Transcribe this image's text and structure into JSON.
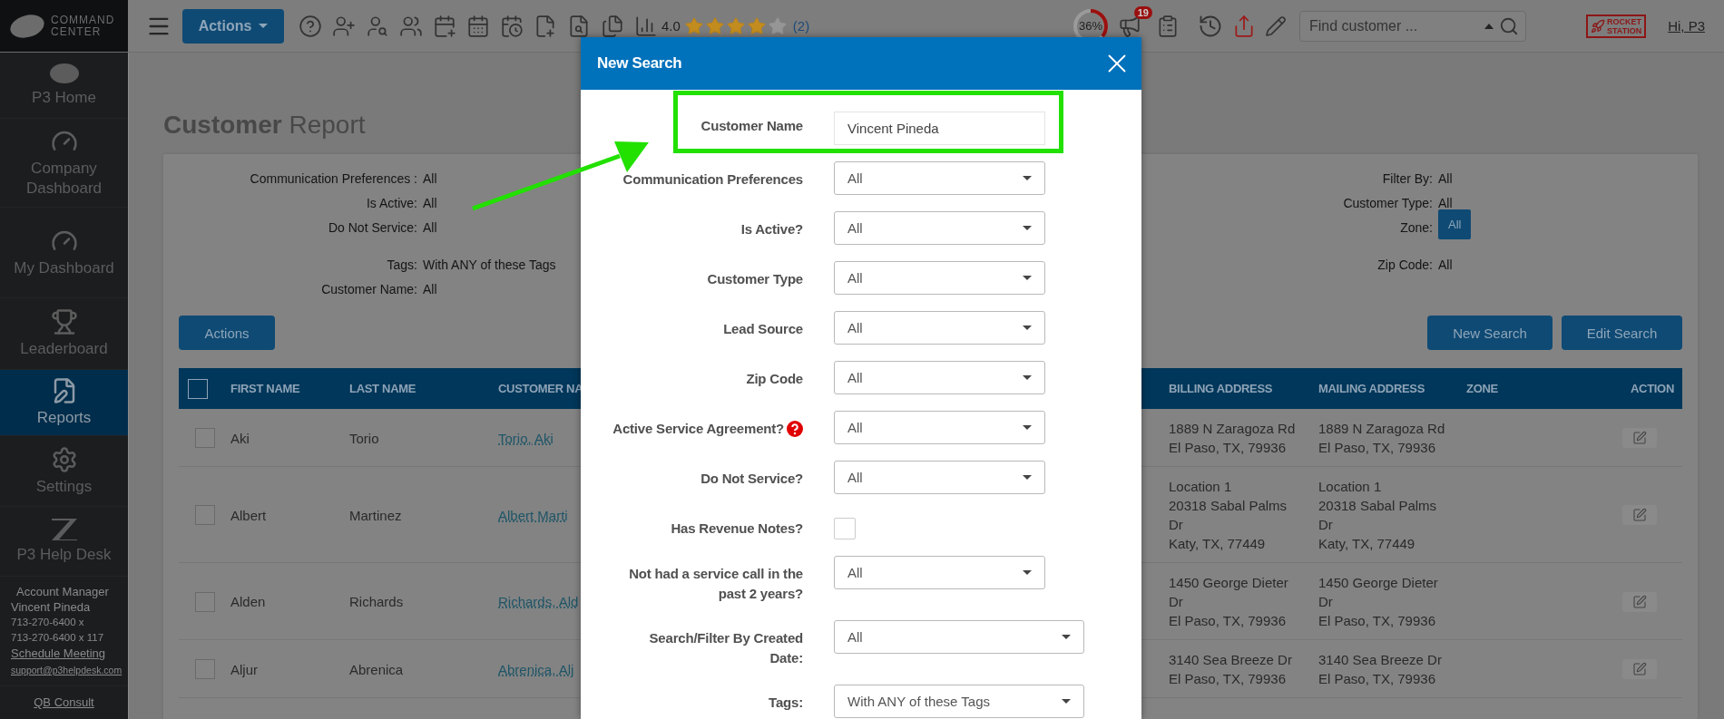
{
  "topbar": {
    "logo_lines": [
      "COMMAND",
      "CENTER"
    ],
    "actions_button": "Actions",
    "rating": {
      "value": "4.0",
      "stars": 4,
      "count": "(2)"
    },
    "progress": {
      "label": "36%",
      "level": 0.36
    },
    "notifications_badge": "19",
    "search": {
      "placeholder": "Find customer ..."
    },
    "brand_lines": [
      "ROCKET",
      "STATION"
    ],
    "greeting": "Hi, P3"
  },
  "sidebar": {
    "items": [
      {
        "label": "P3 Home",
        "selected": false
      },
      {
        "label": "Company Dashboard",
        "selected": false
      },
      {
        "label": "My Dashboard",
        "selected": false
      },
      {
        "label": "Leaderboard",
        "selected": false
      },
      {
        "label": "Reports",
        "selected": true
      },
      {
        "label": "Settings",
        "selected": false
      },
      {
        "label": "P3 Help Desk",
        "selected": false
      }
    ],
    "account": {
      "title": "Account Manager",
      "name": "Vincent Pineda",
      "phones": [
        "713-270-6400 x",
        "713-270-6400 x 117"
      ],
      "schedule_link": "Schedule Meeting",
      "email": "support@p3helpdesk.com"
    },
    "footer_link": "QB Consult"
  },
  "page": {
    "title": "**Customer** Report",
    "filters_left": [
      {
        "label": "Communication Preferences :",
        "value": "All"
      },
      {
        "label": "Is Active:",
        "value": "All"
      },
      {
        "label": "Do Not Service:",
        "value": "All"
      },
      {
        "label": "Tags:",
        "value": "With ANY of these Tags"
      },
      {
        "label": "Customer Name:",
        "value": "All"
      }
    ],
    "filters_right": [
      {
        "label": "Filter By:",
        "value": "All",
        "kind": "text"
      },
      {
        "label": "Customer Type:",
        "value": "All",
        "kind": "text"
      },
      {
        "label": "Zone:",
        "value": "All",
        "kind": "badge"
      },
      {
        "label": "Zip Code:",
        "value": "All",
        "kind": "text"
      }
    ],
    "actions_button": "Actions",
    "buttons": [
      "New Search",
      "Edit Search"
    ]
  },
  "table": {
    "header_checked": false,
    "columns": [
      "FIRST NAME",
      "LAST NAME",
      "CUSTOMER NA",
      "BILLING ADDRESS",
      "MAILING ADDRESS",
      "ZONE",
      "ACTION"
    ],
    "rows": [
      {
        "checked": false,
        "first_name": "Aki",
        "last_name": "Torio",
        "customer_name": "Torio, Aki",
        "billing": [
          "1889 N Zaragoza Rd",
          "El Paso, TX, 79936"
        ],
        "mailing": [
          "1889 N Zaragoza Rd",
          "El Paso, TX, 79936"
        ]
      },
      {
        "checked": false,
        "first_name": "Albert",
        "last_name": "Martinez",
        "customer_name": "Albert Marti",
        "billing": [
          "Location 1",
          "20318 Sabal Palms",
          "Dr",
          "Katy, TX, 77449"
        ],
        "mailing": [
          "Location 1",
          "20318 Sabal Palms",
          "Dr",
          "Katy, TX, 77449"
        ]
      },
      {
        "checked": false,
        "first_name": "Alden",
        "last_name": "Richards",
        "customer_name": "Richards, Ald",
        "billing": [
          "1450 George Dieter",
          "Dr",
          "El Paso, TX, 79936"
        ],
        "mailing": [
          "1450 George Dieter",
          "Dr",
          "El Paso, TX, 79936"
        ]
      },
      {
        "checked": false,
        "first_name": "Aljur",
        "last_name": "Abrenica",
        "customer_name": "Abrenica, Alj",
        "billing": [
          "3140 Sea Breeze Dr",
          "El Paso, TX, 79936"
        ],
        "mailing": [
          "3140 Sea Breeze Dr",
          "El Paso, TX, 79936"
        ]
      }
    ]
  },
  "modal": {
    "title": "New Search",
    "fields": [
      {
        "label": "Customer Name",
        "kind": "text",
        "value": "Vincent Pineda",
        "highlighted": true
      },
      {
        "label": "Communication Preferences",
        "kind": "select",
        "value": "All"
      },
      {
        "label": "Is Active?",
        "kind": "select",
        "value": "All"
      },
      {
        "label": "Customer Type",
        "kind": "select",
        "value": "All"
      },
      {
        "label": "Lead Source",
        "kind": "select",
        "value": "All"
      },
      {
        "label": "Zip Code",
        "kind": "select",
        "value": "All"
      },
      {
        "label": "Active Service Agreement?",
        "kind": "select",
        "value": "All",
        "help": true
      },
      {
        "label": "Do Not Service?",
        "kind": "select",
        "value": "All"
      },
      {
        "label": "Has Revenue Notes?",
        "kind": "checkbox",
        "checked": false
      },
      {
        "label": "Not had a service call in the past 2 years?",
        "kind": "select",
        "value": "All"
      },
      {
        "label": "Search/Filter By Created Date:",
        "kind": "select",
        "value": "All",
        "wide": true
      },
      {
        "label": "Tags:",
        "kind": "select",
        "value": "With ANY of these Tags",
        "wide": true
      }
    ]
  }
}
